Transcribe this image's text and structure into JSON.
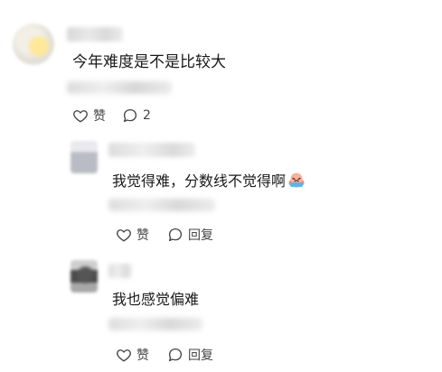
{
  "comment": {
    "text": "今年难度是不是比较大",
    "like_label": "赞",
    "reply_count": "2"
  },
  "replies": [
    {
      "text": "我觉得难，分数线不觉得啊",
      "like_label": "赞",
      "reply_label": "回复",
      "emoji": "crying-face-emoji"
    },
    {
      "text": "我也感觉偏难",
      "like_label": "赞",
      "reply_label": "回复"
    }
  ],
  "icons": {
    "like": "thumbs-up-icon",
    "comment": "comment-bubble-icon"
  },
  "colors": {
    "text": "#1a1a1a",
    "action": "#444444"
  }
}
